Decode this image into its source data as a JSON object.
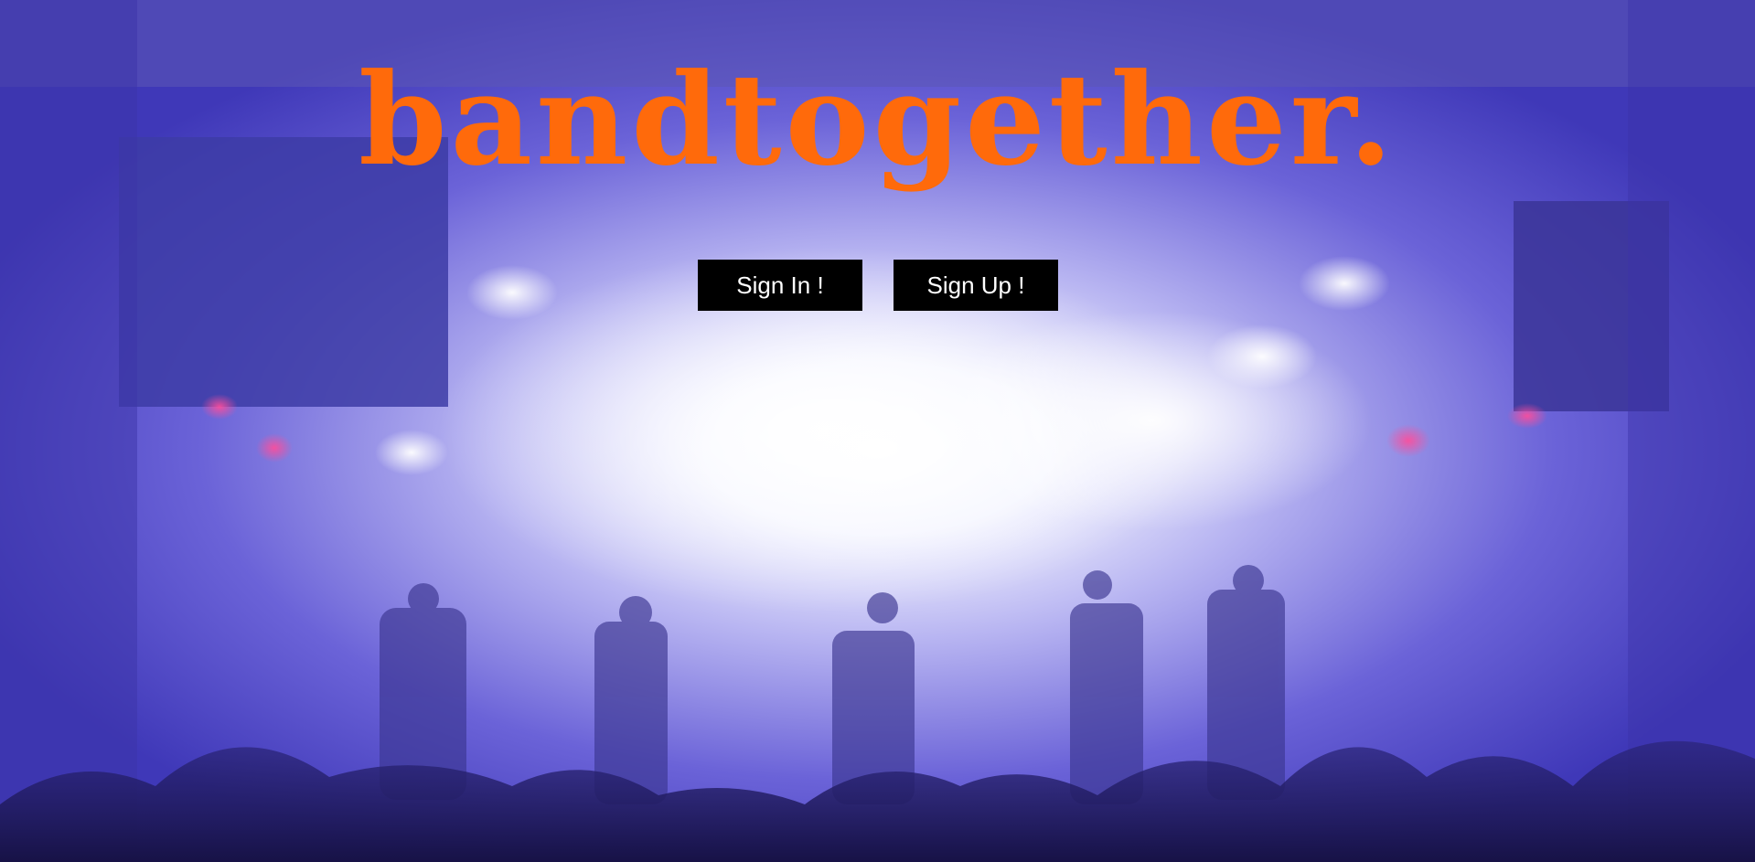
{
  "brand": {
    "name": "bandtogether",
    "dot": ".",
    "color": "#ff6a0b"
  },
  "actions": {
    "sign_in_label": "Sign In !",
    "sign_up_label": "Sign Up !"
  },
  "background": {
    "image": "concert-stage-photo",
    "tint": "#4a44c4"
  }
}
